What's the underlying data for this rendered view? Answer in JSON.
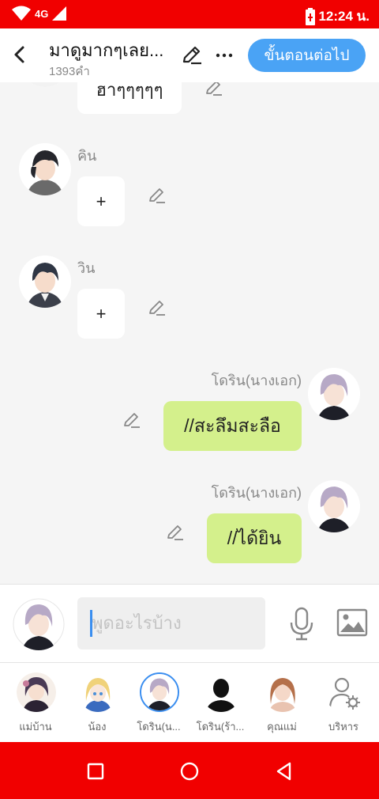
{
  "status_bar": {
    "network": "4G",
    "time": "12:24 น."
  },
  "header": {
    "title": "มาดูมากๆเลย...",
    "subtitle": "1393คำ",
    "next_label": "ขั้นตอนต่อไป"
  },
  "messages": [
    {
      "side": "left",
      "speaker": "",
      "text": "ฮาๆๆๆๆๆ"
    },
    {
      "side": "left",
      "speaker": "คิน",
      "text": "+"
    },
    {
      "side": "left",
      "speaker": "วิน",
      "text": "+"
    },
    {
      "side": "right",
      "speaker": "โดริน(นางเอก)",
      "text": "//สะลึมสะลือ"
    },
    {
      "side": "right",
      "speaker": "โดริน(นางเอก)",
      "text": "//ได้ยิน"
    }
  ],
  "composer": {
    "placeholder": "พูดอะไรบ้าง"
  },
  "characters": [
    {
      "label": "แม่บ้าน"
    },
    {
      "label": "น้อง"
    },
    {
      "label": "โดริน(น..."
    },
    {
      "label": "โดริน(ร้า..."
    },
    {
      "label": "คุณแม่"
    },
    {
      "label": "บริหาร"
    }
  ],
  "colors": {
    "status_bar": "#f10000",
    "accent_blue": "#4aa3f5",
    "green_bubble": "#d4f08c"
  }
}
